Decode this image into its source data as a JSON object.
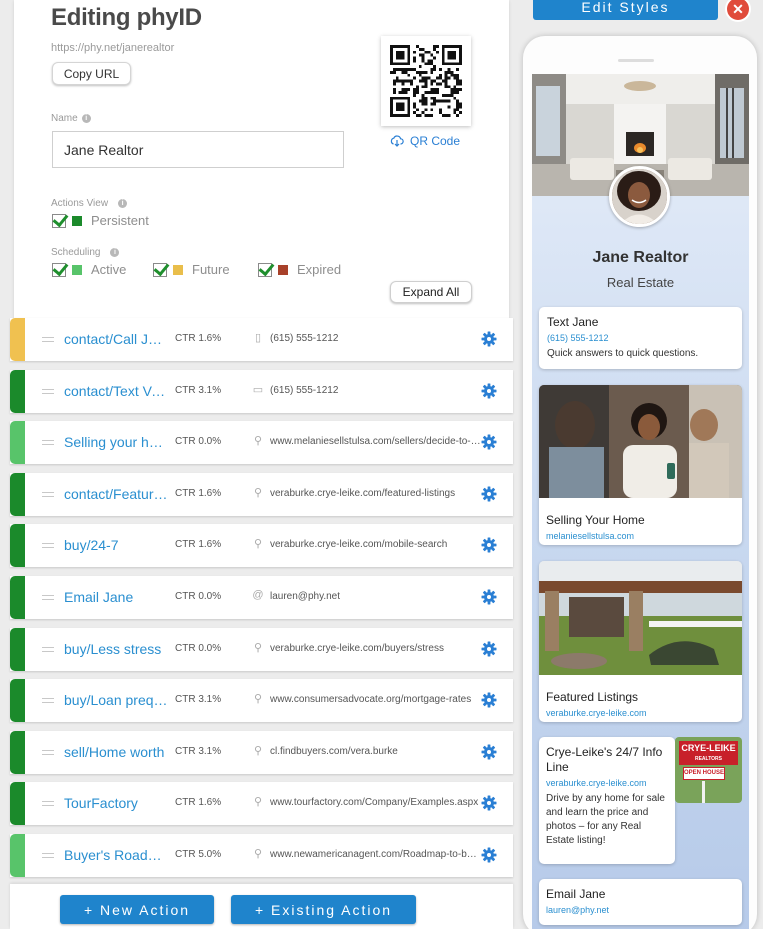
{
  "header": {
    "title": "Editing phyID",
    "url": "https://phy.net/janerealtor",
    "copy_label": "Copy URL"
  },
  "qr": {
    "link_label": "QR Code"
  },
  "name_field": {
    "label": "Name",
    "value": "Jane Realtor"
  },
  "actions_view": {
    "label": "Actions View",
    "option": "Persistent",
    "color": "#1b8a2b"
  },
  "scheduling": {
    "label": "Scheduling",
    "options": [
      {
        "label": "Active",
        "color": "#58c46a"
      },
      {
        "label": "Future",
        "color": "#e9be4b"
      },
      {
        "label": "Expired",
        "color": "#a8412a"
      }
    ]
  },
  "expand_label": "Expand All",
  "actions": [
    {
      "title": "contact/Call Jane",
      "ctr": "CTR 1.6%",
      "icon": "phone-icon",
      "url": "(615) 555-1212",
      "color": "#f0c150"
    },
    {
      "title": "contact/Text Vera",
      "ctr": "CTR 3.1%",
      "icon": "message-icon",
      "url": "(615) 555-1212",
      "color": "#1b8a2b"
    },
    {
      "title": "Selling your home",
      "ctr": "CTR 0.0%",
      "icon": "link-icon",
      "url": "www.melaniesellstulsa.com/sellers/decide-to-sell",
      "color": "#58c46a"
    },
    {
      "title": "contact/Featured Listings",
      "ctr": "CTR 1.6%",
      "icon": "link-icon",
      "url": "veraburke.crye-leike.com/featured-listings",
      "color": "#1b8a2b"
    },
    {
      "title": "buy/24-7",
      "ctr": "CTR 1.6%",
      "icon": "link-icon",
      "url": "veraburke.crye-leike.com/mobile-search",
      "color": "#1b8a2b"
    },
    {
      "title": "Email Jane",
      "ctr": "CTR 0.0%",
      "icon": "at-icon",
      "url": "lauren@phy.net",
      "color": "#1b8a2b"
    },
    {
      "title": "buy/Less stress",
      "ctr": "CTR 0.0%",
      "icon": "link-icon",
      "url": "veraburke.crye-leike.com/buyers/stress",
      "color": "#1b8a2b"
    },
    {
      "title": "buy/Loan prequalification",
      "ctr": "CTR 3.1%",
      "icon": "link-icon",
      "url": "www.consumersadvocate.org/mortgage-rates",
      "color": "#1b8a2b"
    },
    {
      "title": "sell/Home worth",
      "ctr": "CTR 3.1%",
      "icon": "link-icon",
      "url": "cl.findbuyers.com/vera.burke",
      "color": "#1b8a2b"
    },
    {
      "title": "TourFactory",
      "ctr": "CTR 1.6%",
      "icon": "link-icon",
      "url": "www.tourfactory.com/Company/Examples.aspx",
      "color": "#1b8a2b"
    },
    {
      "title": "Buyer's Roadmap",
      "ctr": "CTR 5.0%",
      "icon": "link-icon",
      "url": "www.newamericanagent.com/Roadmap-to-buying",
      "color": "#58c46a"
    }
  ],
  "buttons": {
    "new_action": "+ New Action",
    "existing_action": "+ Existing Action",
    "edit_styles": "Edit Styles"
  },
  "preview": {
    "name": "Jane Realtor",
    "subtitle": "Real Estate",
    "cards": [
      {
        "title": "Text Jane",
        "link": "(615) 555-1212",
        "desc": "Quick answers to quick questions."
      },
      {
        "title": "Selling Your Home",
        "link": "melaniesellstulsa.com"
      },
      {
        "title": "Featured Listings",
        "link": "veraburke.crye-leike.com"
      },
      {
        "title": "Crye-Leike's 24/7 Info Line",
        "link": "veraburke.crye-leike.com",
        "desc": "Drive by any home for sale and learn the price and photos – for any Real Estate listing!"
      },
      {
        "title": "Email Jane",
        "link": "lauren@phy.net"
      }
    ],
    "sign": {
      "brand": "CRYE-LEIKE",
      "sub": "REALTORS",
      "open": "OPEN HOUSE"
    }
  }
}
